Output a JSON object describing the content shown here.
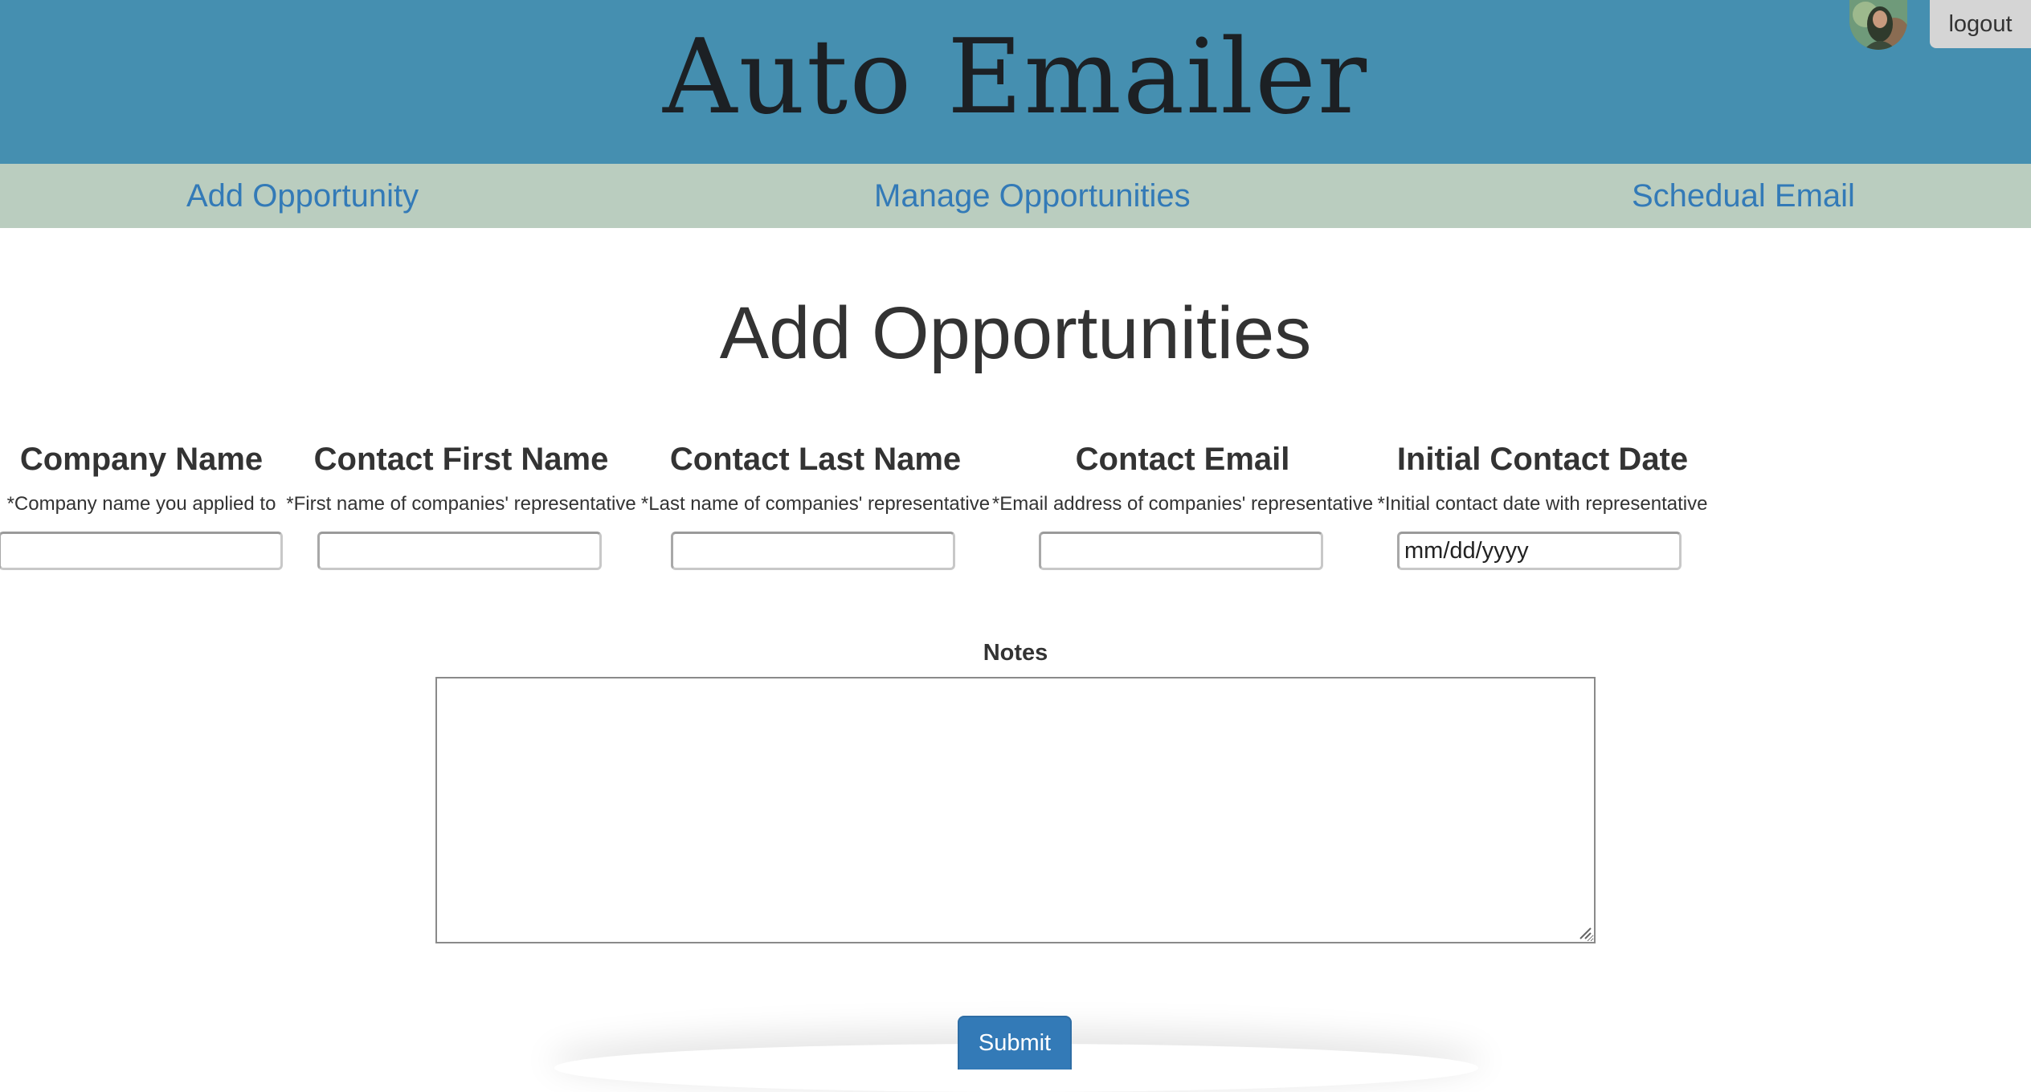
{
  "header": {
    "app_title": "Auto Emailer",
    "logout_label": "logout"
  },
  "nav": {
    "items": [
      {
        "label": "Add Opportunity"
      },
      {
        "label": "Manage Opportunities"
      },
      {
        "label": "Schedual Email"
      }
    ]
  },
  "page": {
    "title": "Add Opportunities"
  },
  "form": {
    "fields": [
      {
        "label": "Company Name",
        "hint": "*Company name you applied to",
        "value": "",
        "placeholder": ""
      },
      {
        "label": "Contact First Name",
        "hint": "*First name of companies' representative",
        "value": "",
        "placeholder": ""
      },
      {
        "label": "Contact Last Name",
        "hint": "*Last name of companies' representative",
        "value": "",
        "placeholder": ""
      },
      {
        "label": "Contact Email",
        "hint": "*Email address of companies' representative",
        "value": "",
        "placeholder": ""
      },
      {
        "label": "Initial Contact Date",
        "hint": "*Initial contact date with representative",
        "value": "",
        "placeholder": "mm/dd/yyyy"
      }
    ],
    "notes_label": "Notes",
    "notes_value": "",
    "submit_label": "Submit"
  },
  "colors": {
    "header_bg": "#458fb0",
    "nav_bg": "#bacdbf",
    "link": "#337ab7",
    "button_primary": "#337ab7",
    "logout_bg": "#d5d5d5"
  }
}
